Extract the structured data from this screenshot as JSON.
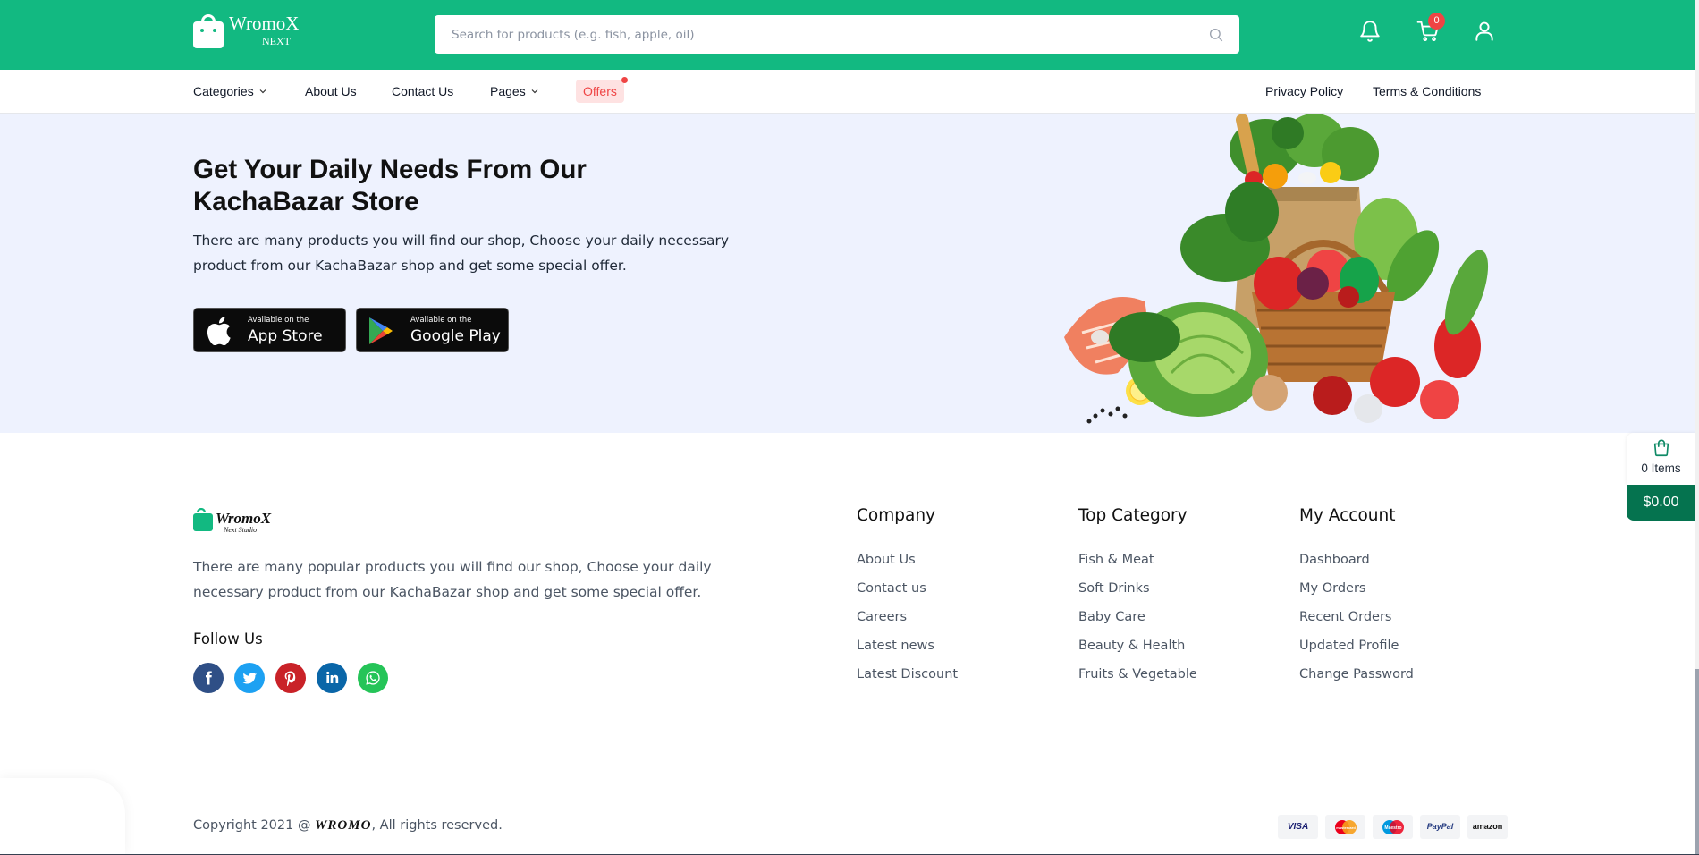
{
  "header": {
    "logo_name": "WromoX",
    "logo_sub": "NEXT",
    "search_placeholder": "Search for products (e.g. fish, apple, oil)",
    "cart_count": "0",
    "brand_color": "#12b981"
  },
  "nav": {
    "categories": "Categories",
    "about": "About Us",
    "contact": "Contact Us",
    "pages": "Pages",
    "offers": "Offers",
    "privacy": "Privacy Policy",
    "terms": "Terms & Conditions"
  },
  "promo": {
    "title": "Get Your Daily Needs From Our KachaBazar Store",
    "text": "There are many products you will find our shop, Choose your daily necessary product from our KachaBazar shop and get some special offer.",
    "app_store_small": "Available on the",
    "app_store_big": "App Store",
    "google_small": "Available on the",
    "google_big": "Google Play"
  },
  "float_cart": {
    "items": "0 Items",
    "price": "$0.00"
  },
  "footer": {
    "description": "There are many popular products you will find our shop, Choose your daily necessary product from our KachaBazar shop and get some special offer.",
    "follow_us": "Follow Us",
    "company": {
      "title": "Company",
      "links": [
        "About Us",
        "Contact us",
        "Careers",
        "Latest news",
        "Latest Discount"
      ]
    },
    "top_category": {
      "title": "Top Category",
      "links": [
        "Fish & Meat",
        "Soft Drinks",
        "Baby Care",
        "Beauty & Health",
        "Fruits & Vegetable"
      ]
    },
    "my_account": {
      "title": "My Account",
      "links": [
        "Dashboard",
        "My Orders",
        "Recent Orders",
        "Updated Profile",
        "Change Password"
      ]
    },
    "copyright_prefix": "Copyright 2021 @",
    "copyright_brand": "WROMO",
    "copyright_suffix": ", All rights reserved.",
    "payments": [
      "VISA",
      "mastercard",
      "Maestro",
      "PayPal",
      "amazon"
    ]
  },
  "social_icons": [
    "facebook-icon",
    "twitter-icon",
    "pinterest-icon",
    "linkedin-icon",
    "whatsapp-icon"
  ]
}
